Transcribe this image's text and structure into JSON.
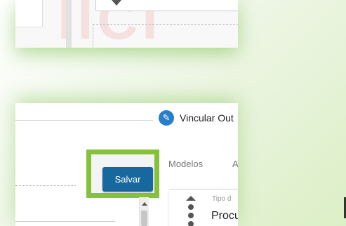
{
  "header": {
    "vincular_label": "Vincular Out"
  },
  "actions": {
    "save_label": "Salvar"
  },
  "tabs": [
    {
      "label": "Modelos"
    },
    {
      "label": "A"
    }
  ],
  "side_card": {
    "type_label": "Tipo d",
    "value_text": "Procu"
  },
  "colors": {
    "highlight": "#85c13b",
    "save_button": "#16689e",
    "edit_icon": "#2a7dc9"
  },
  "icons": [
    "edit-pencil-icon",
    "chevron-up-icon",
    "drag-handle-icon"
  ]
}
